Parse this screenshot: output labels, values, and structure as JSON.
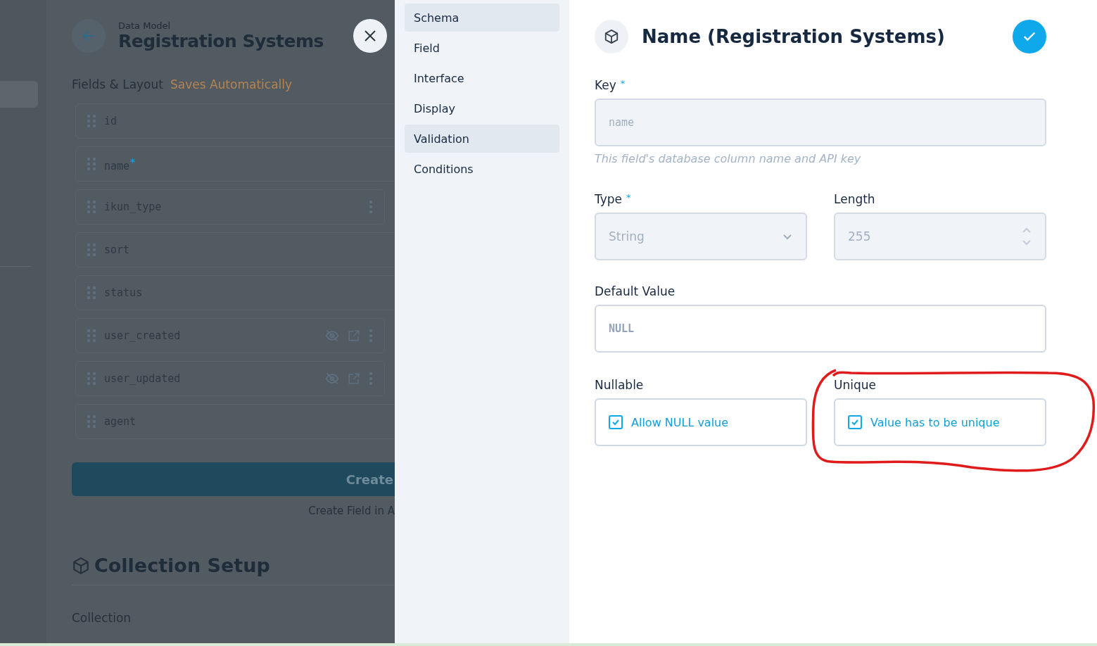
{
  "background_page": {
    "breadcrumb": "Data Model",
    "title": "Registration Systems",
    "section_title": "Fields & Layout",
    "save_status": "Saves Automatically",
    "fields": [
      {
        "name": "id",
        "kind": "full",
        "hidden": false
      },
      {
        "name": "name",
        "mark": "*",
        "kind": "full",
        "hidden": false
      },
      {
        "name": "ikun_type",
        "kind": "half",
        "hidden": false
      },
      {
        "name": "sort",
        "kind": "full",
        "hidden": false
      },
      {
        "name": "status",
        "kind": "full",
        "hidden": false
      },
      {
        "name": "user_created",
        "kind": "half",
        "hidden": true
      },
      {
        "name": "user_updated",
        "kind": "half",
        "hidden": true
      },
      {
        "name": "agent",
        "kind": "full",
        "hidden": false
      }
    ],
    "create_button": "Create",
    "create_hint": "Create Field in A",
    "setup_title": "Collection Setup",
    "setup_label": "Collection"
  },
  "drawer_nav": [
    {
      "label": "Schema",
      "selected": true
    },
    {
      "label": "Field",
      "selected": false
    },
    {
      "label": "Interface",
      "selected": false
    },
    {
      "label": "Display",
      "selected": false
    },
    {
      "label": "Validation",
      "selected": true
    },
    {
      "label": "Conditions",
      "selected": false
    }
  ],
  "drawer": {
    "title": "Name (Registration Systems)",
    "key": {
      "label": "Key",
      "required_mark": "*",
      "value": "name",
      "disabled": true,
      "hint": "This field's database column name and API key"
    },
    "type": {
      "label": "Type",
      "required_mark": "*",
      "value": "String",
      "disabled": true
    },
    "length": {
      "label": "Length",
      "value": "255",
      "disabled": true
    },
    "default_value": {
      "label": "Default Value",
      "placeholder": "NULL",
      "disabled": false
    },
    "nullable": {
      "label": "Nullable",
      "option": "Allow NULL value",
      "checked": true
    },
    "unique": {
      "label": "Unique",
      "option": "Value has to be unique",
      "checked": true
    }
  }
}
